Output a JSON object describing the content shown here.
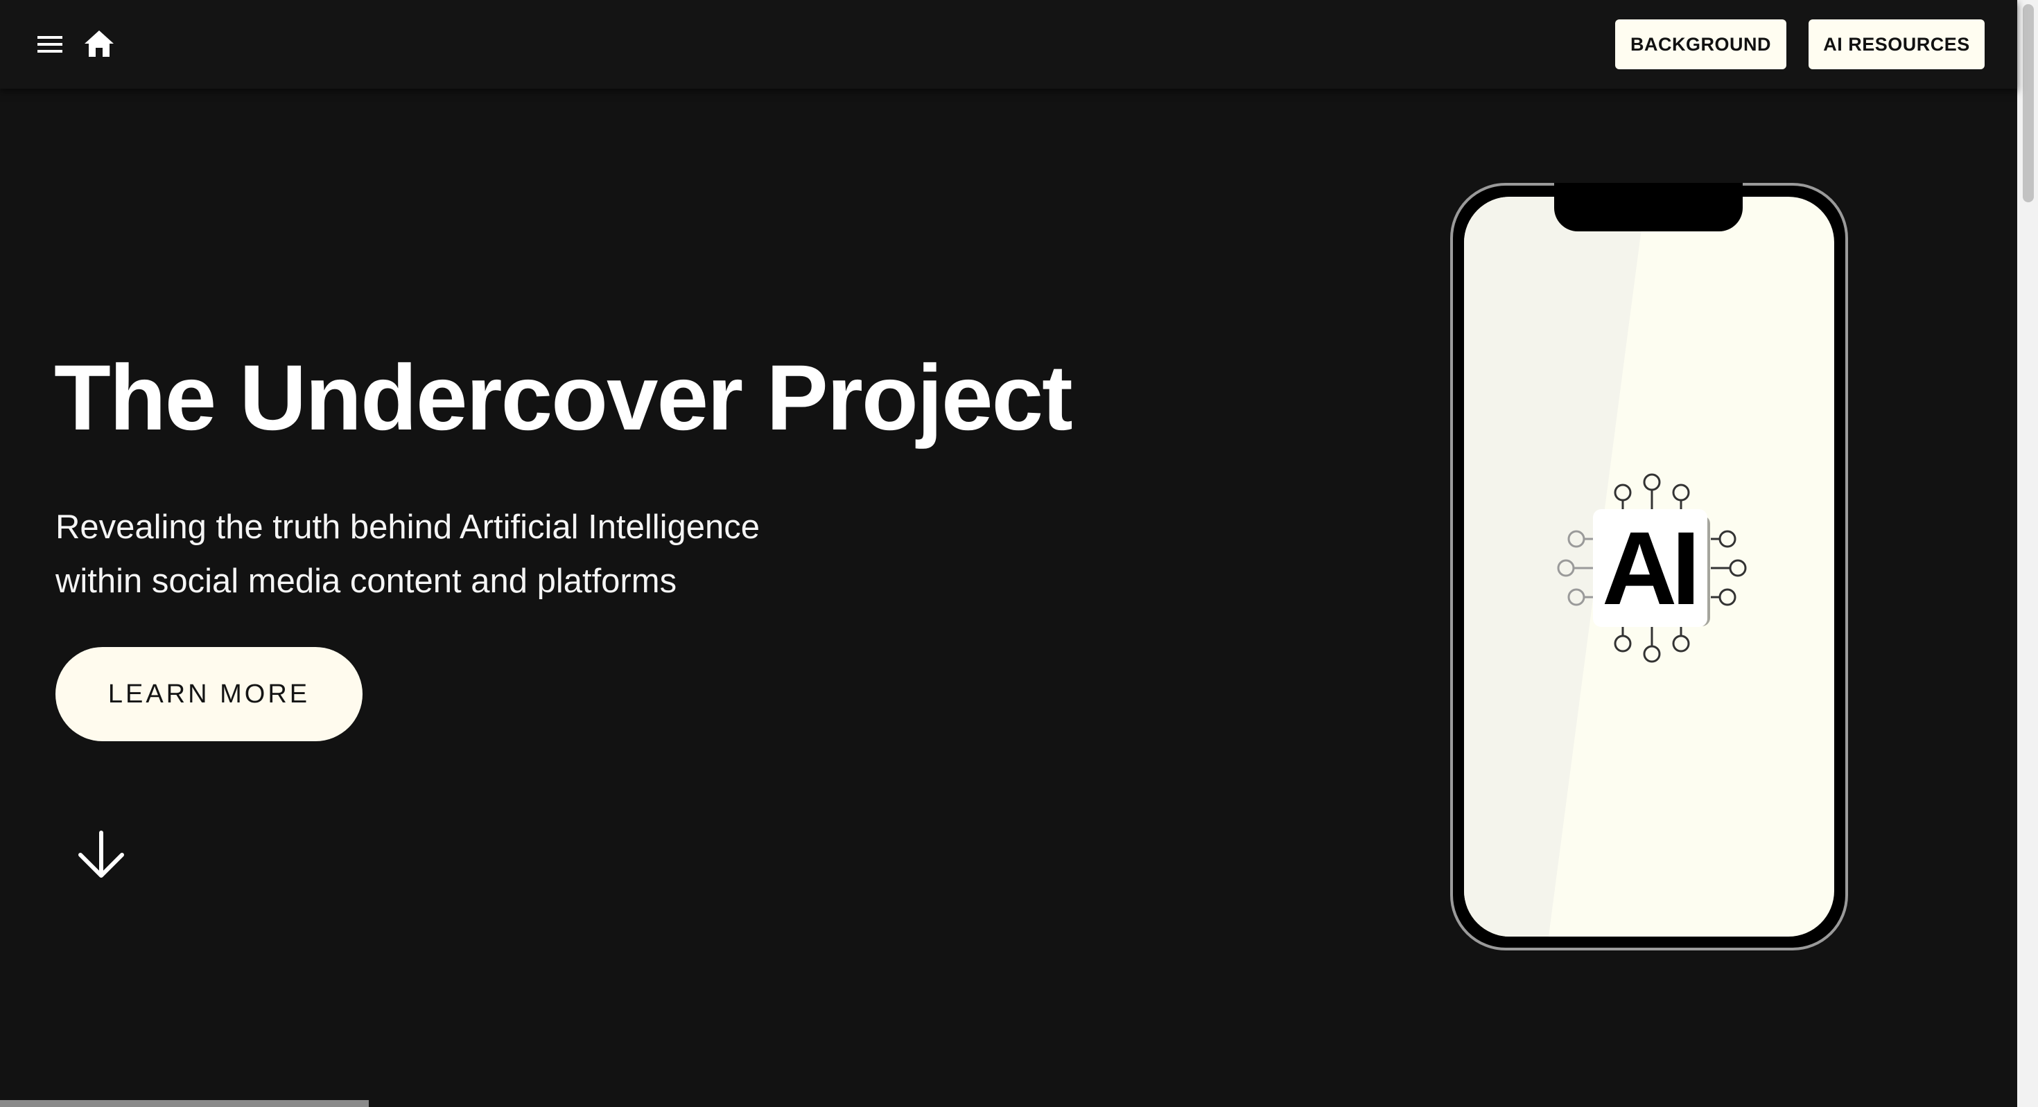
{
  "header": {
    "menu_icon": "hamburger-menu-icon",
    "home_icon": "home-icon",
    "nav": [
      {
        "label": "BACKGROUND"
      },
      {
        "label": "AI RESOURCES"
      }
    ]
  },
  "hero": {
    "title": "The Undercover Project",
    "subtitle_lines": [
      "Revealing the truth behind Artificial Intelligence",
      "within social media content and platforms"
    ],
    "cta_label": "LEARN MORE",
    "scroll_icon": "arrow-down-icon"
  },
  "illustration": {
    "phone_icon": "smartphone-icon",
    "chip_icon": "ai-chip-icon",
    "chip_text": "AI"
  },
  "colors": {
    "background": "#121212",
    "header": "#141414",
    "button_fill": "#fffdf1",
    "screen_fill": "#fdfdf1"
  }
}
